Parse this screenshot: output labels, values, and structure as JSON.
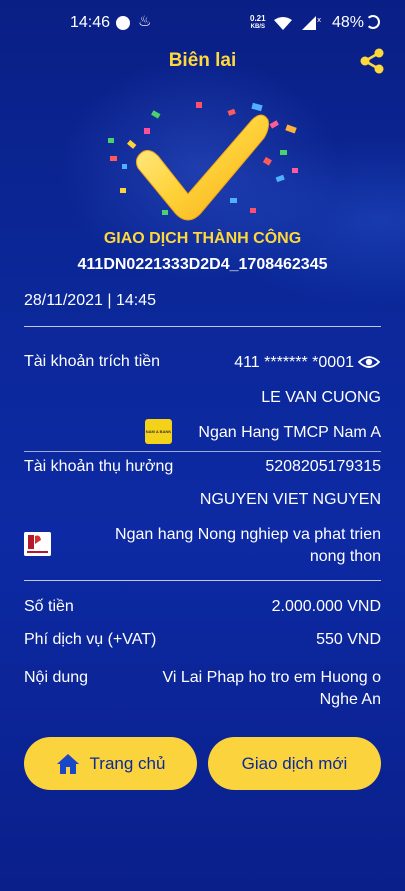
{
  "status_bar": {
    "time": "14:46",
    "net_speed_value": "0.21",
    "net_speed_unit": "KB/S",
    "battery": "48%"
  },
  "header": {
    "title": "Biên lai",
    "share_icon": "share-icon"
  },
  "receipt": {
    "status": "GIAO DỊCH THÀNH CÔNG",
    "transaction_id": "411DN0221333D2D4_1708462345",
    "datetime": "28/11/2021 | 14:45",
    "source": {
      "label": "Tài khoản trích tiền",
      "account": "411 ******* *0001",
      "name": "LE VAN CUONG",
      "bank": "Ngan Hang TMCP Nam A"
    },
    "beneficiary": {
      "label": "Tài khoản thụ hưởng",
      "account": "5208205179315",
      "name": "NGUYEN VIET NGUYEN",
      "bank": "Ngan hang Nong nghiep va phat trien nong thon"
    },
    "amount": {
      "label": "Số tiền",
      "value": "2.000.000 VND"
    },
    "fee": {
      "label": "Phí dịch vụ (+VAT)",
      "value": "550 VND"
    },
    "content": {
      "label": "Nội dung",
      "value": "Vi Lai Phap ho tro em Huong o Nghe An"
    }
  },
  "actions": {
    "home_label": "Trang chủ",
    "new_label": "Giao dịch mới"
  },
  "colors": {
    "accent": "#ffd83a",
    "button_bg": "#fbd33d",
    "background": "#0b2797"
  }
}
